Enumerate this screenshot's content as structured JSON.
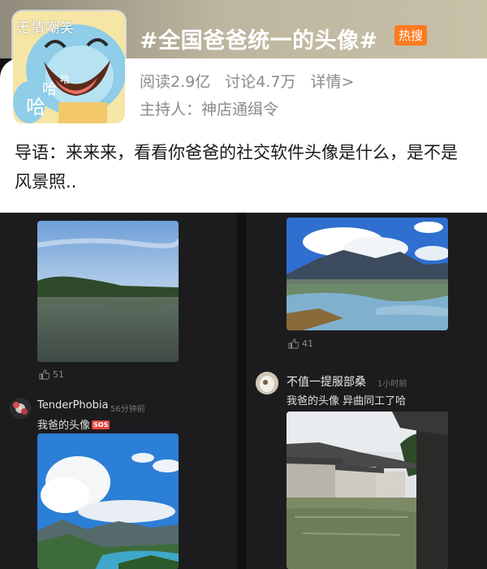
{
  "topic": {
    "title": "#全国爸爸统一的头像#",
    "hot_badge": "热搜",
    "reads": "阅读2.9亿",
    "discussions": "讨论4.7万",
    "details": "详情>",
    "host": "主持人：神店通缉令",
    "intro": "导语：来来来，看看你爸爸的社交软件头像是什么，是不是风景照..",
    "thumb_watermark": "无情嘲笑",
    "thumb_text": "哈"
  },
  "left_column": {
    "post1": {
      "likes": "51"
    },
    "post2": {
      "username": "TenderPhobia",
      "time": "56分钟前",
      "text": "我爸的头像",
      "sos_badge": "SOS"
    }
  },
  "right_column": {
    "post1": {
      "likes": "41"
    },
    "post2": {
      "username": "不值一提服部桑",
      "time": "1小时前",
      "text": "我爸的头像 异曲同工了哈"
    }
  },
  "colors": {
    "header_bg": "#bdb59f",
    "hot_badge": "#ff7a1f",
    "feed_bg": "#1c1c1e",
    "sos_badge": "#e8453c"
  }
}
